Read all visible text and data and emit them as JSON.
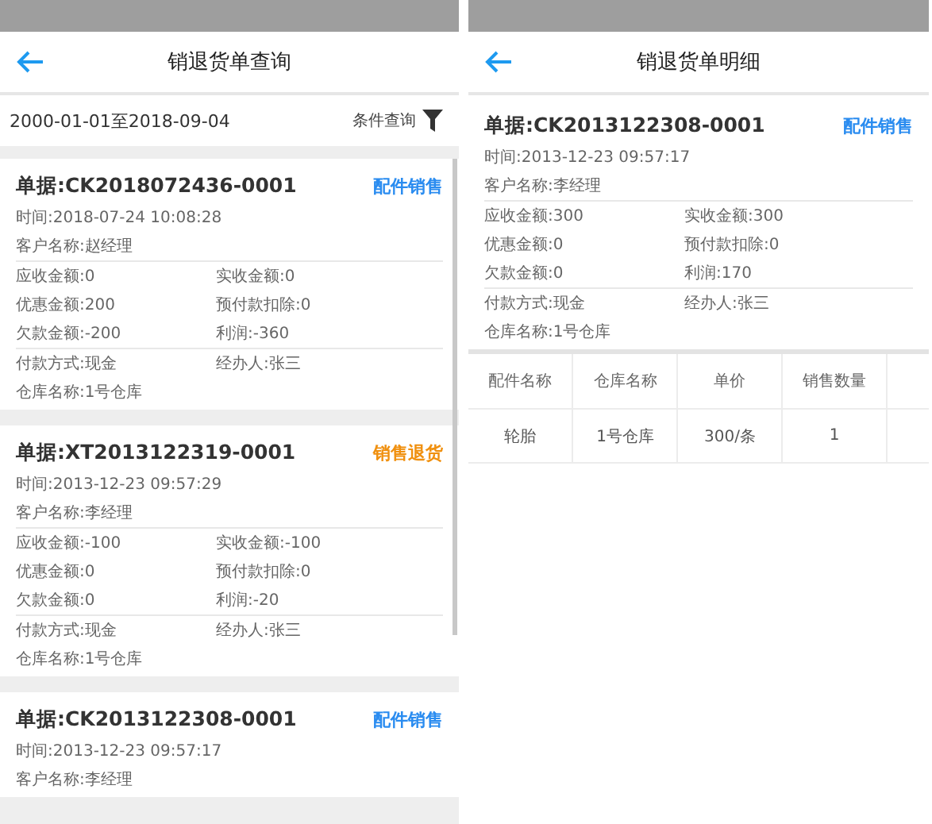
{
  "screens": [
    {
      "kind": "list",
      "title": "销退货单查询",
      "filter": {
        "date_range": "2000-01-01至2018-09-04",
        "button": "条件查询"
      },
      "cards": [
        {
          "number": "单据:CK2018072436-0001",
          "type": "配件销售",
          "color": "#2a8cf0",
          "sections": [
            [
              [
                "时间:2018-07-24 10:08:28"
              ],
              [
                "客户名称:赵经理"
              ]
            ],
            [
              [
                "应收金额:0",
                "实收金额:0"
              ],
              [
                "优惠金额:200",
                "预付款扣除:0"
              ],
              [
                "欠款金额:-200",
                "利润:-360"
              ]
            ],
            [
              [
                "付款方式:现金",
                "经办人:张三"
              ],
              [
                "仓库名称:1号仓库"
              ]
            ]
          ]
        },
        {
          "number": "单据:XT2013122319-0001",
          "type": "销售退货",
          "color": "#f0900f",
          "sections": [
            [
              [
                "时间:2013-12-23 09:57:29"
              ],
              [
                "客户名称:李经理"
              ]
            ],
            [
              [
                "应收金额:-100",
                "实收金额:-100"
              ],
              [
                "优惠金额:0",
                "预付款扣除:0"
              ],
              [
                "欠款金额:0",
                "利润:-20"
              ]
            ],
            [
              [
                "付款方式:现金",
                "经办人:张三"
              ],
              [
                "仓库名称:1号仓库"
              ]
            ]
          ]
        },
        {
          "number": "单据:CK2013122308-0001",
          "type": "配件销售",
          "color": "#2a8cf0",
          "sections": [
            [
              [
                "时间:2013-12-23 09:57:17"
              ],
              [
                "客户名称:李经理"
              ]
            ]
          ]
        }
      ]
    },
    {
      "kind": "detail",
      "title": "销退货单明细",
      "card": {
        "number": "单据:CK2013122308-0001",
        "type": "配件销售",
        "color": "#2a8cf0",
        "sections": [
          [
            [
              "时间:2013-12-23 09:57:17"
            ],
            [
              "客户名称:李经理"
            ]
          ],
          [
            [
              "应收金额:300",
              "实收金额:300"
            ],
            [
              "优惠金额:0",
              "预付款扣除:0"
            ],
            [
              "欠款金额:0",
              "利润:170"
            ]
          ],
          [
            [
              "付款方式:现金",
              "经办人:张三"
            ],
            [
              "仓库名称:1号仓库"
            ]
          ]
        ]
      },
      "table": {
        "columns": [
          "配件名称",
          "仓库名称",
          "单价",
          "销售数量"
        ],
        "rows": [
          [
            "轮胎",
            "1号仓库",
            "300/条",
            "1"
          ]
        ]
      }
    }
  ]
}
